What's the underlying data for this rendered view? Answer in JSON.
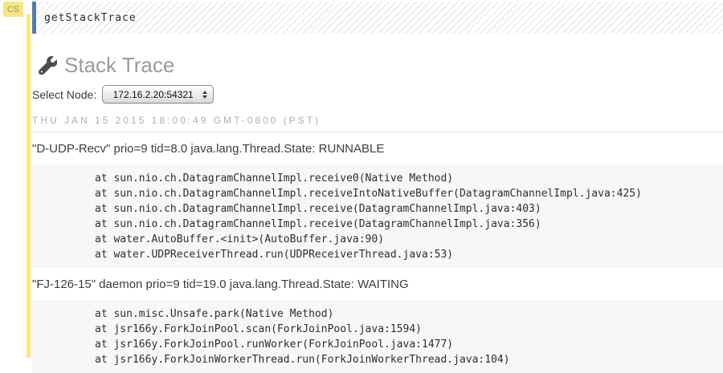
{
  "badge": {
    "label": "CS"
  },
  "cell": {
    "command": "getStackTrace"
  },
  "header": {
    "title": "Stack Trace",
    "icon": "wrench-icon"
  },
  "node_selector": {
    "label": "Select Node:",
    "selected": "172.16.2.20:54321",
    "icon": "select-updown-arrows-icon"
  },
  "timestamp": "THU JAN 15 2015 18:00:49 GMT-0800 (PST)",
  "threads": [
    {
      "header": "\"D-UDP-Recv\" prio=9 tid=8.0 java.lang.Thread.State: RUNNABLE",
      "frames": [
        "at sun.nio.ch.DatagramChannelImpl.receive0(Native Method)",
        "at sun.nio.ch.DatagramChannelImpl.receiveIntoNativeBuffer(DatagramChannelImpl.java:425)",
        "at sun.nio.ch.DatagramChannelImpl.receive(DatagramChannelImpl.java:403)",
        "at sun.nio.ch.DatagramChannelImpl.receive(DatagramChannelImpl.java:356)",
        "at water.AutoBuffer.<init>(AutoBuffer.java:90)",
        "at water.UDPReceiverThread.run(UDPReceiverThread.java:53)"
      ]
    },
    {
      "header": "\"FJ-126-15\" daemon prio=9 tid=19.0 java.lang.Thread.State: WAITING",
      "frames": [
        "at sun.misc.Unsafe.park(Native Method)",
        "at jsr166y.ForkJoinPool.scan(ForkJoinPool.java:1594)",
        "at jsr166y.ForkJoinPool.runWorker(ForkJoinPool.java:1477)",
        "at jsr166y.ForkJoinWorkerThread.run(ForkJoinWorkerThread.java:104)"
      ]
    }
  ],
  "colors": {
    "highlight_yellow": "#f6e87d",
    "cell_accent_blue": "#4e7cba",
    "block_background": "#f7f7f7",
    "heading_gray": "#9b9b9b",
    "timestamp_gray": "#b5aea7"
  }
}
